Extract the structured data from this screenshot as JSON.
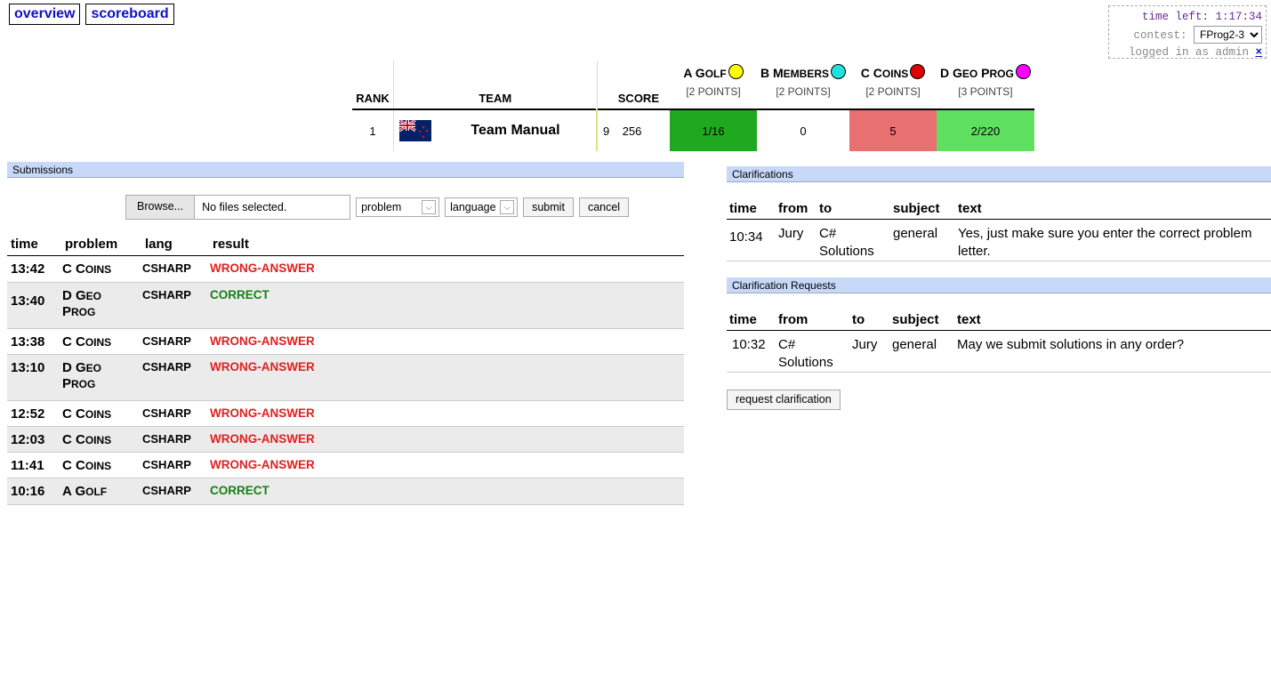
{
  "nav": {
    "overview": "overview",
    "scoreboard": "scoreboard"
  },
  "status": {
    "time_left": "time left: 1:17:34",
    "contest_label": "contest:",
    "contest_value": "FProg2-3",
    "logged_in": "logged in as admin",
    "logout": "×"
  },
  "scoreboard": {
    "headers": {
      "rank": "RANK",
      "team": "TEAM",
      "score": "SCORE"
    },
    "problems": [
      {
        "letter": "A",
        "name_cap": "G",
        "name_rest": "OLF",
        "points": "[2 POINTS]",
        "color": "#ffff00"
      },
      {
        "letter": "B",
        "name_cap": "M",
        "name_rest": "EMBERS",
        "points": "[2 POINTS]",
        "color": "#22e0e0"
      },
      {
        "letter": "C",
        "name_cap": "C",
        "name_rest": "OINS",
        "points": "[2 POINTS]",
        "color": "#e00000"
      },
      {
        "letter": "D",
        "name_cap": "G",
        "name_rest": "EO P",
        "name_cap2": "P",
        "points": "[3 POINTS]",
        "color": "#ff00ff"
      }
    ],
    "row": {
      "rank": "1",
      "team": "Team Manual",
      "solved": "9",
      "time": "256",
      "cells": [
        {
          "text": "1/16",
          "color": "#20a820"
        },
        {
          "text": "0",
          "color": "#ffffff"
        },
        {
          "text": "5",
          "color": "#e87070"
        },
        {
          "text": "2/220",
          "color": "#60e060"
        }
      ]
    }
  },
  "submissions": {
    "title": "Submissions",
    "form": {
      "browse": "Browse...",
      "no_file": "No files selected.",
      "problem": "problem",
      "language": "language",
      "submit": "submit",
      "cancel": "cancel"
    },
    "headers": {
      "time": "time",
      "problem": "problem",
      "lang": "lang",
      "result": "result"
    },
    "rows": [
      {
        "time": "13:42",
        "p1": "C C",
        "p2": "OINS",
        "p3": "",
        "lang": "CSHARP",
        "result": "WRONG-ANSWER",
        "ok": false
      },
      {
        "time": "13:40",
        "p1": "D G",
        "p2": "EO",
        "p3": "P|ROG",
        "lang": "CSHARP",
        "result": "CORRECT",
        "ok": true
      },
      {
        "time": "13:38",
        "p1": "C C",
        "p2": "OINS",
        "p3": "",
        "lang": "CSHARP",
        "result": "WRONG-ANSWER",
        "ok": false
      },
      {
        "time": "13:10",
        "p1": "D G",
        "p2": "EO",
        "p3": "P|ROG",
        "lang": "CSHARP",
        "result": "WRONG-ANSWER",
        "ok": false
      },
      {
        "time": "12:52",
        "p1": "C C",
        "p2": "OINS",
        "p3": "",
        "lang": "CSHARP",
        "result": "WRONG-ANSWER",
        "ok": false
      },
      {
        "time": "12:03",
        "p1": "C C",
        "p2": "OINS",
        "p3": "",
        "lang": "CSHARP",
        "result": "WRONG-ANSWER",
        "ok": false
      },
      {
        "time": "11:41",
        "p1": "C C",
        "p2": "OINS",
        "p3": "",
        "lang": "CSHARP",
        "result": "WRONG-ANSWER",
        "ok": false
      },
      {
        "time": "10:16",
        "p1": "A G",
        "p2": "OLF",
        "p3": "",
        "lang": "CSHARP",
        "result": "CORRECT",
        "ok": true
      }
    ]
  },
  "clarifications": {
    "title": "Clarifications",
    "headers": {
      "time": "time",
      "from": "from",
      "to": "to",
      "subject": "subject",
      "text": "text"
    },
    "rows": [
      {
        "time": "10:34",
        "from": "Jury",
        "to": "C# Solutions",
        "subject": "general",
        "text": "Yes, just make sure you enter the correct problem letter."
      }
    ]
  },
  "requests": {
    "title": "Clarification Requests",
    "headers": {
      "time": "time",
      "from": "from",
      "to": "to",
      "subject": "subject",
      "text": "text"
    },
    "rows": [
      {
        "time": "10:32",
        "from": "C# Solutions",
        "to": "Jury",
        "subject": "general",
        "text": "May we submit solutions in any order?"
      }
    ],
    "button": "request clarification"
  }
}
